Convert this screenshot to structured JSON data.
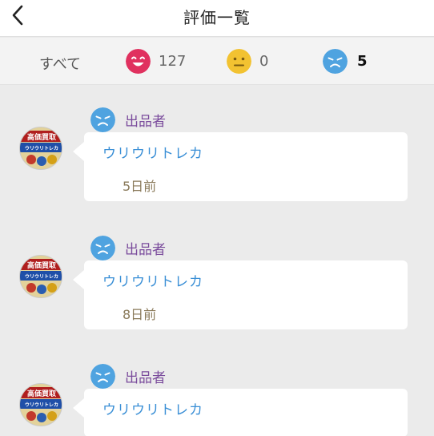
{
  "header": {
    "title": "評価一覧"
  },
  "filters": {
    "all_label": "すべて",
    "good_count": "127",
    "normal_count": "0",
    "bad_count": "5"
  },
  "colors": {
    "good": "#e0315f",
    "normal": "#f2c231",
    "bad": "#4fa3e0",
    "role": "#7a4b9c",
    "username": "#3a8fd6"
  },
  "reviews": [
    {
      "role": "出品者",
      "username": "ウリウリトレカ",
      "date": "5日前",
      "avatar_lines": [
        "高価買取",
        "ウリウリトレカ"
      ]
    },
    {
      "role": "出品者",
      "username": "ウリウリトレカ",
      "date": "8日前",
      "avatar_lines": [
        "高価買取",
        "ウリウリトレカ"
      ]
    },
    {
      "role": "出品者",
      "username": "ウリウリトレカ",
      "date": "",
      "avatar_lines": [
        "高価買取",
        "ウリウリトレカ"
      ]
    }
  ]
}
